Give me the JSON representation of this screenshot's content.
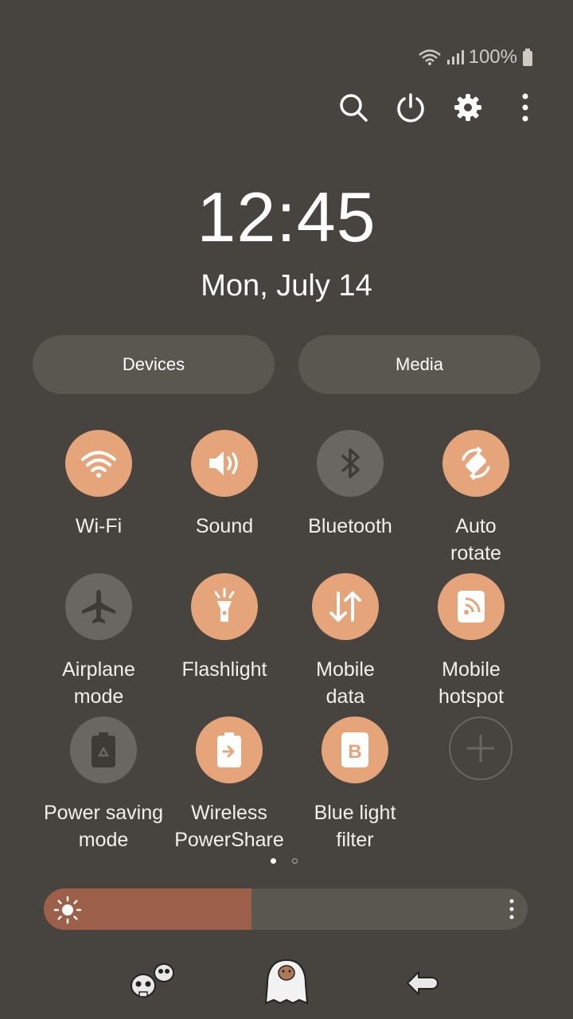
{
  "status_bar": {
    "battery_text": "100%",
    "wifi_icon": "wifi-icon",
    "signal_icon": "signal-icon",
    "battery_icon": "battery-icon"
  },
  "toolbar": {
    "icons": [
      "search-icon",
      "power-icon",
      "settings-gear-icon",
      "more-vert-icon"
    ]
  },
  "clock": {
    "time": "12:45",
    "date": "Mon, July 14"
  },
  "panels": {
    "devices_label": "Devices",
    "media_label": "Media"
  },
  "tiles": [
    {
      "label1": "Wi-Fi",
      "label2": "",
      "state": "on",
      "icon": "wifi-icon"
    },
    {
      "label1": "Sound",
      "label2": "",
      "state": "on",
      "icon": "volume-icon"
    },
    {
      "label1": "Bluetooth",
      "label2": "",
      "state": "off",
      "icon": "bluetooth-icon"
    },
    {
      "label1": "Auto",
      "label2": "rotate",
      "state": "on",
      "icon": "rotate-icon"
    },
    {
      "label1": "Airplane",
      "label2": "mode",
      "state": "off",
      "icon": "airplane-icon"
    },
    {
      "label1": "Flashlight",
      "label2": "",
      "state": "on",
      "icon": "flashlight-icon"
    },
    {
      "label1": "Mobile",
      "label2": "data",
      "state": "on",
      "icon": "mobile-data-icon"
    },
    {
      "label1": "Mobile",
      "label2": "hotspot",
      "state": "on",
      "icon": "hotspot-icon"
    },
    {
      "label1": "Power saving",
      "label2": "mode",
      "state": "off",
      "icon": "battery-saver-icon"
    },
    {
      "label1": "Wireless",
      "label2": "PowerShare",
      "state": "on",
      "icon": "powershare-icon"
    },
    {
      "label1": "Blue light",
      "label2": "filter",
      "state": "on",
      "icon": "blue-light-icon"
    },
    {
      "label1": "",
      "label2": "",
      "state": "add",
      "icon": "add-icon"
    }
  ],
  "page_indicator": {
    "current": 1,
    "total": 2
  },
  "brightness": {
    "level": 0.43,
    "icon": "sun-icon",
    "menu_icon": "more-vert-icon"
  },
  "bottom_nav": {
    "icons": [
      "skulls-sticker-icon",
      "capybara-ghost-icon",
      "back-arrow-icon"
    ]
  },
  "colors": {
    "background": "#47433e",
    "accent": "#e5a47a",
    "tile_off": "#6a6662",
    "pill": "#5a5650",
    "brightness_fill": "#9c604a"
  }
}
